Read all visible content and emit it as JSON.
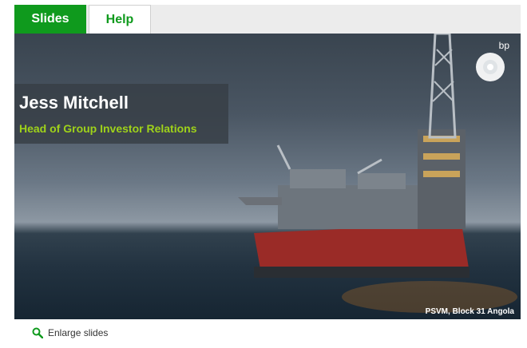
{
  "tabs": {
    "slides": "Slides",
    "help": "Help"
  },
  "slide": {
    "name": "Jess Mitchell",
    "title": "Head of Group Investor Relations",
    "logo_text": "bp",
    "caption": "PSVM, Block 31 Angola"
  },
  "footer": {
    "enlarge_label": "Enlarge slides",
    "enlarge_icon": "magnifier-icon"
  },
  "colors": {
    "accent": "#0f9a1d",
    "title_green": "#9fd21a"
  }
}
